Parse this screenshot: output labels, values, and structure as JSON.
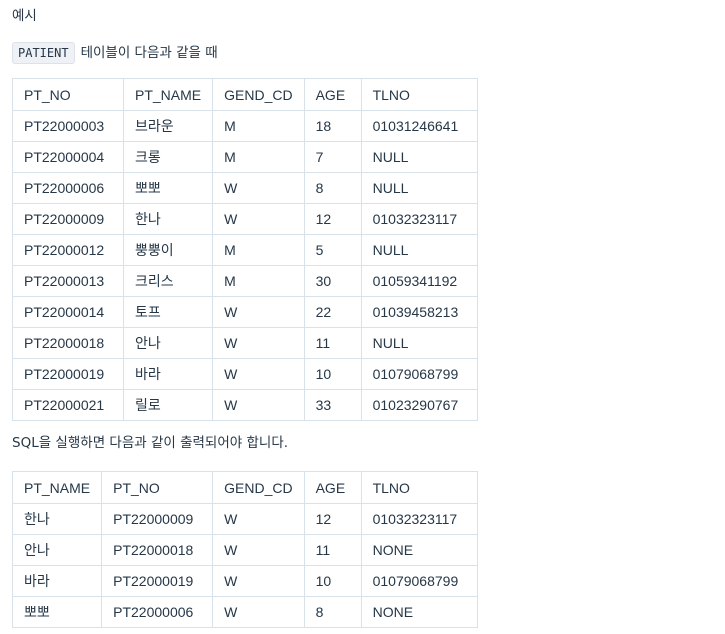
{
  "heading": "예시",
  "intro": {
    "table_name": "PATIENT",
    "text": "테이블이 다음과 같을 때"
  },
  "patient_table": {
    "headers": [
      "PT_NO",
      "PT_NAME",
      "GEND_CD",
      "AGE",
      "TLNO"
    ],
    "rows": [
      [
        "PT22000003",
        "브라운",
        "M",
        "18",
        "01031246641"
      ],
      [
        "PT22000004",
        "크롱",
        "M",
        "7",
        "NULL"
      ],
      [
        "PT22000006",
        "뽀뽀",
        "W",
        "8",
        "NULL"
      ],
      [
        "PT22000009",
        "한나",
        "W",
        "12",
        "01032323117"
      ],
      [
        "PT22000012",
        "뿡뿡이",
        "M",
        "5",
        "NULL"
      ],
      [
        "PT22000013",
        "크리스",
        "M",
        "30",
        "01059341192"
      ],
      [
        "PT22000014",
        "토프",
        "W",
        "22",
        "01039458213"
      ],
      [
        "PT22000018",
        "안나",
        "W",
        "11",
        "NULL"
      ],
      [
        "PT22000019",
        "바라",
        "W",
        "10",
        "01079068799"
      ],
      [
        "PT22000021",
        "릴로",
        "W",
        "33",
        "01023290767"
      ]
    ]
  },
  "sql_text": "SQL을 실행하면 다음과 같이 출력되어야 합니다.",
  "result_table": {
    "headers": [
      "PT_NAME",
      "PT_NO",
      "GEND_CD",
      "AGE",
      "TLNO"
    ],
    "rows": [
      [
        "한나",
        "PT22000009",
        "W",
        "12",
        "01032323117"
      ],
      [
        "안나",
        "PT22000018",
        "W",
        "11",
        "NONE"
      ],
      [
        "바라",
        "PT22000019",
        "W",
        "10",
        "01079068799"
      ],
      [
        "뽀뽀",
        "PT22000006",
        "W",
        "8",
        "NONE"
      ]
    ]
  }
}
